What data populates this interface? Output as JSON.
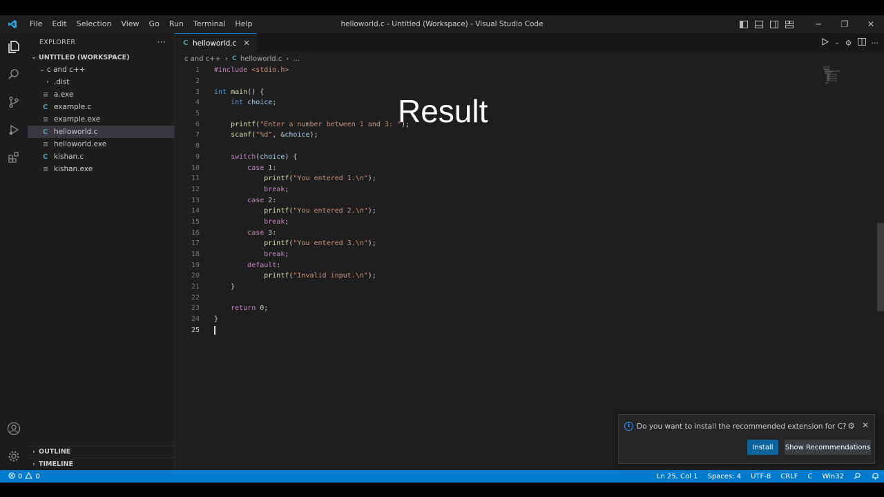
{
  "window": {
    "title": "helloworld.c - Untitled (Workspace) - Visual Studio Code",
    "menu": [
      "File",
      "Edit",
      "Selection",
      "View",
      "Go",
      "Run",
      "Terminal",
      "Help"
    ]
  },
  "sidebar": {
    "header": "EXPLORER",
    "workspace": "UNTITLED (WORKSPACE)",
    "folder": "c and c++",
    "items": [
      {
        "label": ".dist",
        "type": "folder"
      },
      {
        "label": "a.exe",
        "type": "exe"
      },
      {
        "label": "example.c",
        "type": "c"
      },
      {
        "label": "example.exe",
        "type": "exe"
      },
      {
        "label": "helloworld.c",
        "type": "c",
        "selected": true
      },
      {
        "label": "helloworld.exe",
        "type": "exe"
      },
      {
        "label": "kishan.c",
        "type": "c"
      },
      {
        "label": "kishan.exe",
        "type": "exe"
      }
    ],
    "outline": "OUTLINE",
    "timeline": "TIMELINE"
  },
  "editor": {
    "tab": "helloworld.c",
    "breadcrumb": [
      "c and c++",
      "helloworld.c",
      "..."
    ],
    "overlay": "Result",
    "code_lines": [
      "#include <stdio.h>",
      "",
      "int main() {",
      "    int choice;",
      "",
      "    printf(\"Enter a number between 1 and 3: \");",
      "    scanf(\"%d\", &choice);",
      "",
      "    switch(choice) {",
      "        case 1:",
      "            printf(\"You entered 1.\\n\");",
      "            break;",
      "        case 2:",
      "            printf(\"You entered 2.\\n\");",
      "            break;",
      "        case 3:",
      "            printf(\"You entered 3.\\n\");",
      "            break;",
      "        default:",
      "            printf(\"Invalid input.\\n\");",
      "    }",
      "",
      "    return 0;",
      "}",
      ""
    ],
    "current_line": 25
  },
  "notification": {
    "message": "Do you want to install the recommended extension for C?",
    "install": "Install",
    "show": "Show Recommendations"
  },
  "status": {
    "errors": "0",
    "warnings": "0",
    "position": "Ln 25, Col 1",
    "spaces": "Spaces: 4",
    "encoding": "UTF-8",
    "eol": "CRLF",
    "language": "C",
    "platform": "Win32"
  },
  "colors": {
    "accent": "#007acc",
    "install_button": "#0e639c"
  }
}
